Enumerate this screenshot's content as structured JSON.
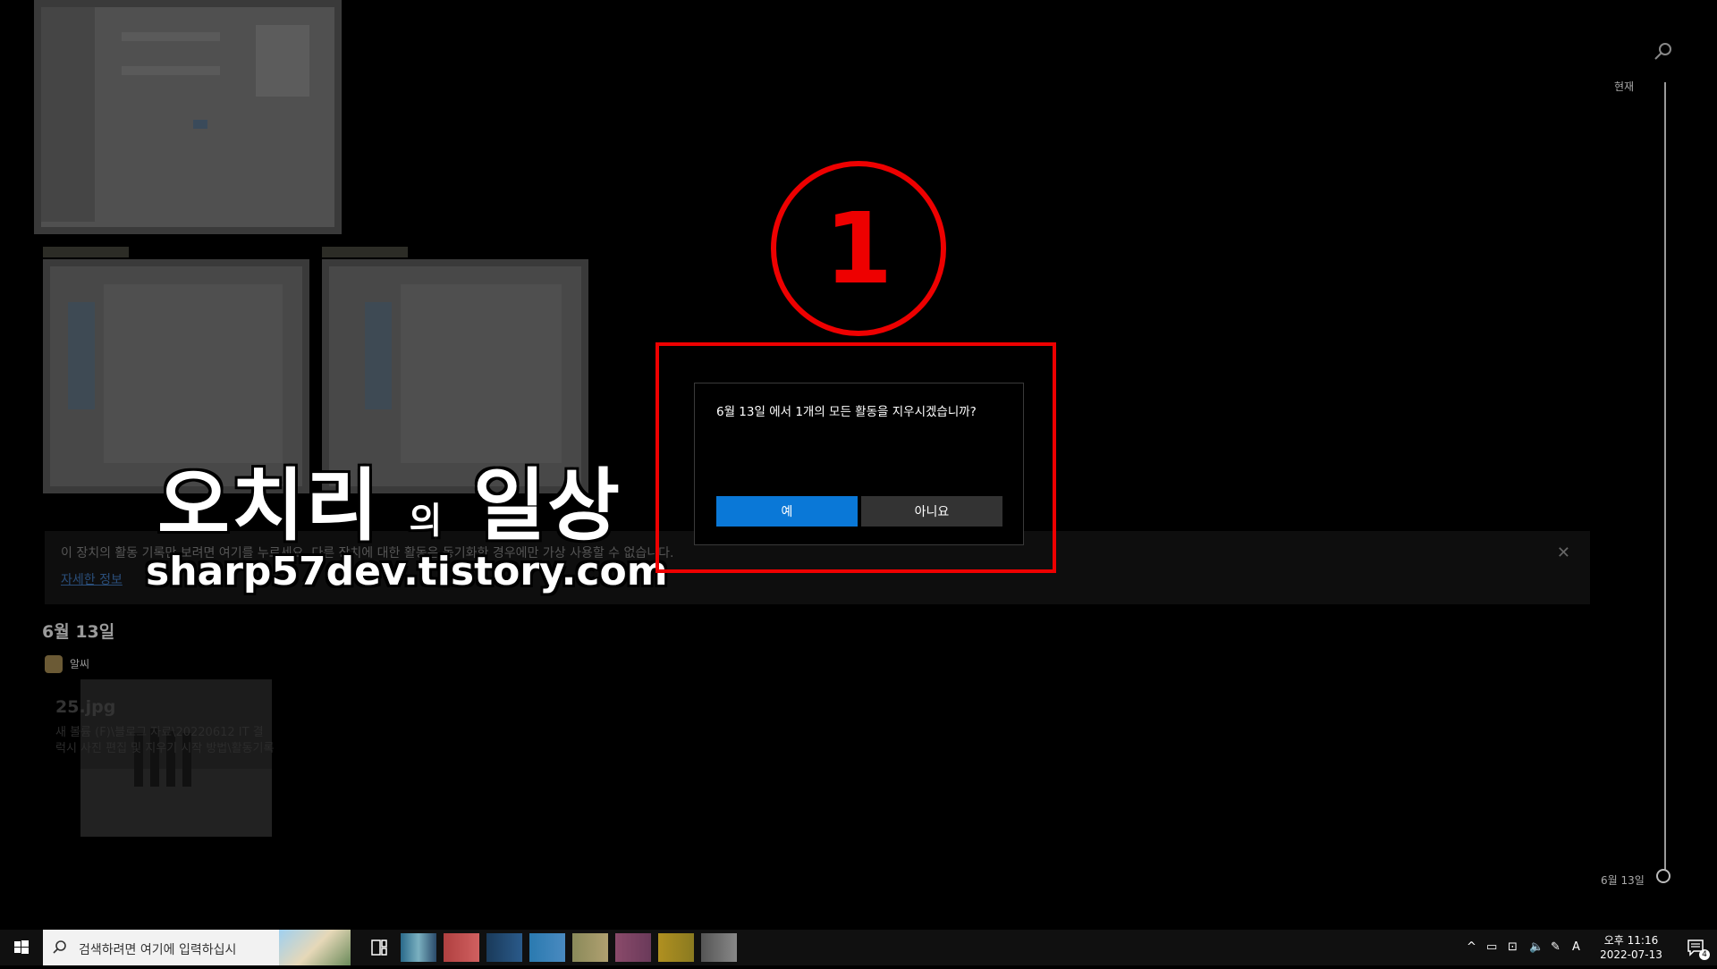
{
  "timeline": {
    "now_label": "현재",
    "date_label": "6월 13일",
    "search_icon": "search-icon"
  },
  "notice": {
    "text": "이 장치의 활동 기록만 보려면 여기를 누르세요. 다른 장치에 대한 활동은 동기화한 경우에만 가상 사용할 수 없습니다.",
    "link": "자세한 정보",
    "close_icon": "close-icon"
  },
  "section": {
    "date_heading": "6월 13일",
    "app_name": "알씨",
    "card_title": "25.jpg",
    "card_path1": "새 볼륨 (F)\\블로그 자료\\20220612 IT 결",
    "card_path2": "럭시 사진 편집 및 지우기 시작 방법\\활동기록"
  },
  "watermark": {
    "title_main": "오치리",
    "title_small": "의",
    "title_end": "일상",
    "url": "sharp57dev.tistory.com"
  },
  "annotation": {
    "number": "1",
    "color": "#ee0000"
  },
  "dialog": {
    "message": "6월 13일 에서 1개의 모든 활동을 지우시겠습니까?",
    "yes_label": "예",
    "no_label": "아니요",
    "yes_color": "#0a78d7"
  },
  "taskbar": {
    "search_placeholder": "검색하려면 여기에 입력하십시",
    "tray_chevron": "^",
    "ime": "A",
    "time": "오후 11:16",
    "date": "2022-07-13",
    "notification_count": "4"
  }
}
